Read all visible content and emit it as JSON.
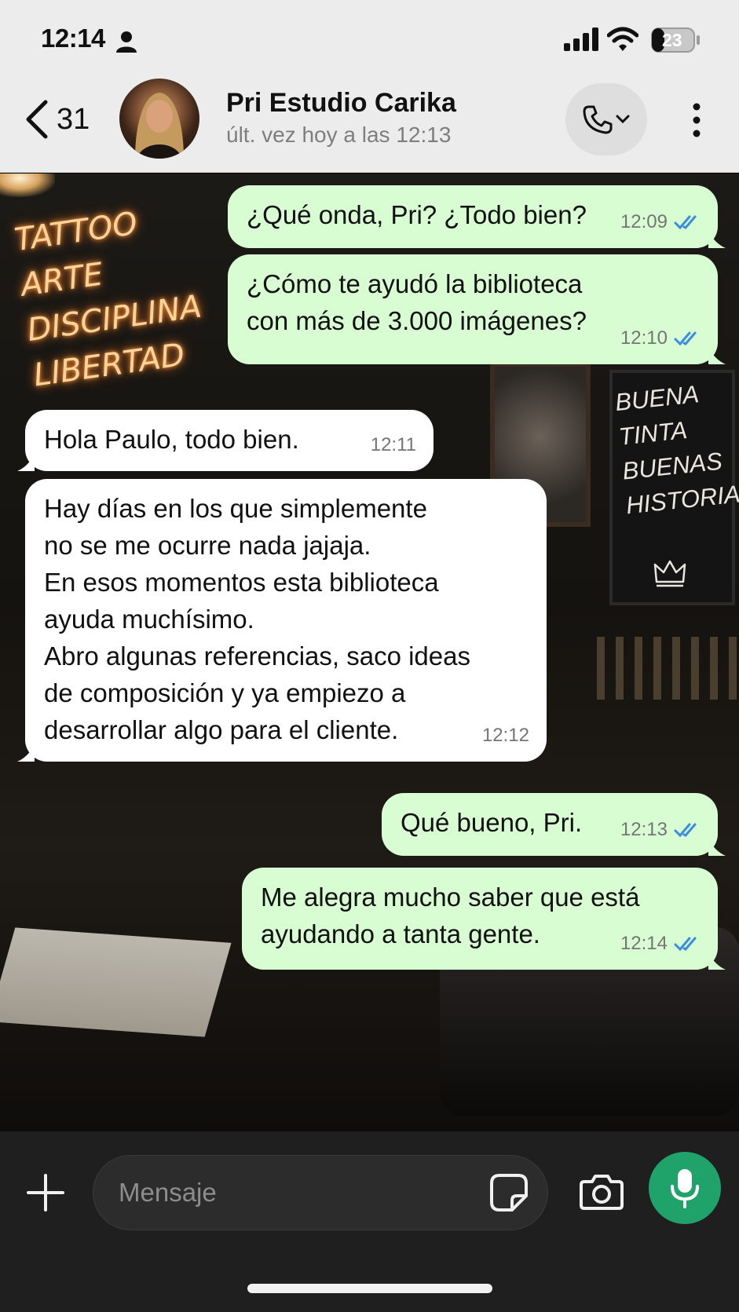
{
  "status_bar": {
    "time": "12:14",
    "battery": "23"
  },
  "header": {
    "back_count": "31",
    "contact_name": "Pri Estudio Carika",
    "last_seen": "últ. vez hoy a las 12:13"
  },
  "background": {
    "neon_lines": [
      "TATTOO",
      "ARTE",
      "DISCIPLINA",
      "LIBERTAD"
    ],
    "chalkboard_lines": [
      "BUENA",
      "TINTA",
      "BUENAS",
      "HISTORIAS"
    ]
  },
  "messages": [
    {
      "direction": "out",
      "text": "¿Qué onda, Pri? ¿Todo bien?",
      "time": "12:09",
      "read": true
    },
    {
      "direction": "out",
      "text": "¿Cómo te ayudó la biblioteca\ncon más de 3.000 imágenes?",
      "time": "12:10",
      "read": true
    },
    {
      "direction": "in",
      "text": "Hola Paulo, todo bien.",
      "time": "12:11"
    },
    {
      "direction": "in",
      "text": "Hay días en los que simplemente\nno se me ocurre nada jajaja.\nEn esos momentos esta biblioteca\nayuda muchísimo.\nAbro algunas referencias, saco ideas\nde composición y ya empiezo a\ndesarrollar algo para el cliente.",
      "time": "12:12"
    },
    {
      "direction": "out",
      "text": "Qué bueno, Pri.",
      "time": "12:13",
      "read": true
    },
    {
      "direction": "out",
      "text": "Me alegra mucho saber que está\nayudando a tanta gente.",
      "time": "12:14",
      "read": true
    }
  ],
  "composer": {
    "placeholder": "Mensaje"
  },
  "colors": {
    "outgoing_bubble": "#d9fdd3",
    "incoming_bubble": "#ffffff",
    "read_ticks": "#3b8de0",
    "mic_button": "#1fa36b"
  }
}
